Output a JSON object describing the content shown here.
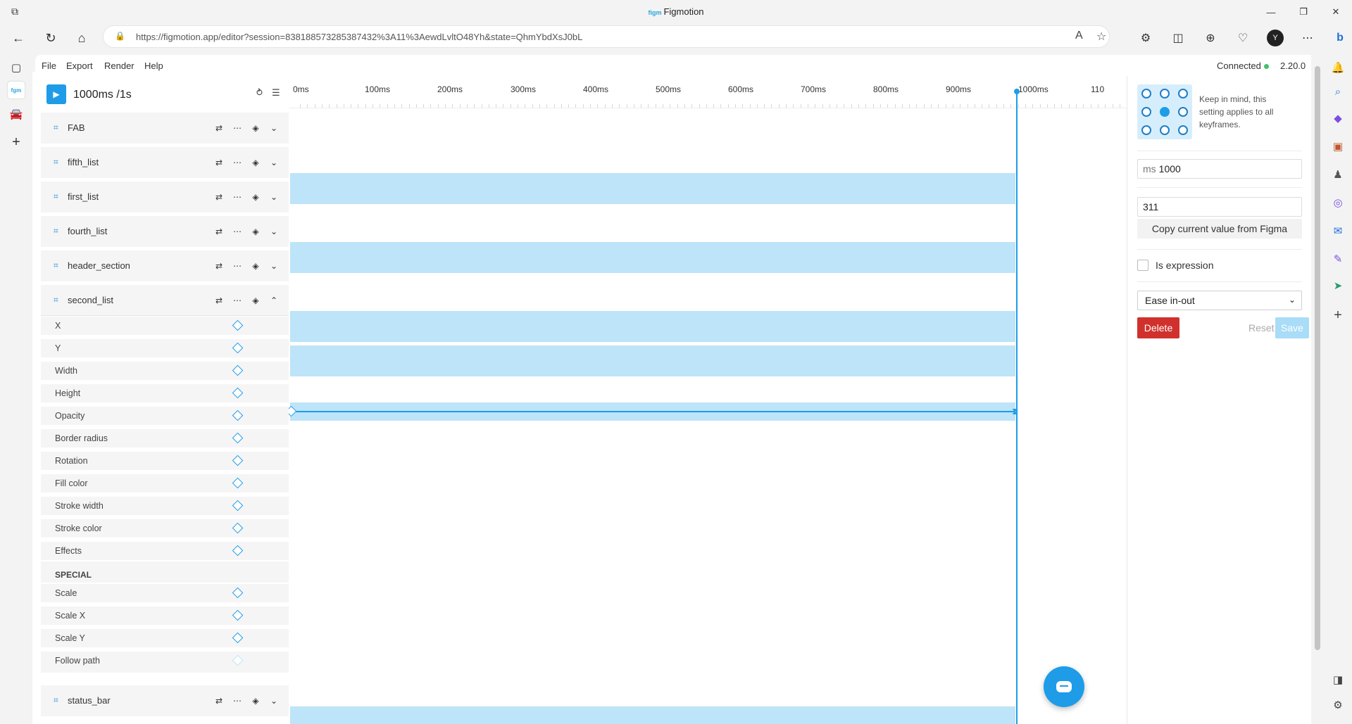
{
  "browser": {
    "window_title": "Figmotion",
    "title_logo_text": "figm",
    "url_host": "https://figmotion.app",
    "url_rest": "/editor?session=838188573285387432%3A11%3AewdLvltO48Yh&state=QhmYbdXsJ0bL",
    "avatar_letter": "Y"
  },
  "menu": {
    "items": [
      "File",
      "Export",
      "Render",
      "Help"
    ],
    "status": "Connected",
    "version": "2.20.0"
  },
  "playback": {
    "time": "1000ms /1s"
  },
  "layers": [
    {
      "name": "FAB",
      "has_bar": true
    },
    {
      "name": "fifth_list",
      "has_bar": false
    },
    {
      "name": "first_list",
      "has_bar": true
    },
    {
      "name": "fourth_list",
      "has_bar": false
    },
    {
      "name": "header_section",
      "has_bar": true
    },
    {
      "name": "second_list",
      "has_bar": true,
      "expanded": true
    },
    {
      "name": "status_bar",
      "has_bar": true
    }
  ],
  "properties": [
    "X",
    "Y",
    "Width",
    "Height",
    "Opacity",
    "Border radius",
    "Rotation",
    "Fill color",
    "Stroke width",
    "Stroke color",
    "Effects"
  ],
  "special_label": "SPECIAL",
  "special_properties": [
    "Scale",
    "Scale X",
    "Scale Y",
    "Follow path"
  ],
  "ruler": [
    "0ms",
    "100ms",
    "200ms",
    "300ms",
    "400ms",
    "500ms",
    "600ms",
    "700ms",
    "800ms",
    "900ms",
    "1000ms",
    "110"
  ],
  "inspector": {
    "hint": "Keep in mind, this setting applies to all keyframes.",
    "ms_prefix": "ms",
    "time_value": "1000",
    "value": "311",
    "copy_label": "Copy current value from Figma",
    "expression_label": "Is expression",
    "easing": "Ease in-out",
    "delete_label": "Delete",
    "reset_label": "Reset",
    "save_label": "Save"
  },
  "colors": {
    "accent": "#1e9ce8",
    "bar": "#bde4f8",
    "delete": "#d0312d",
    "connected": "#3fc26b"
  }
}
